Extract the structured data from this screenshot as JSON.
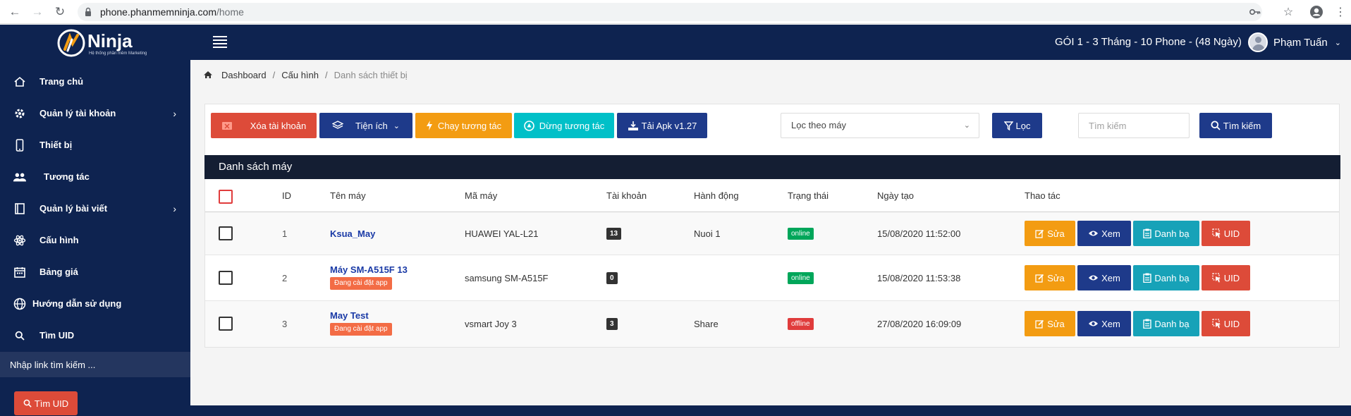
{
  "browser": {
    "url_host": "phone.phanmemninja.com",
    "url_path": "/home"
  },
  "topbar": {
    "logo_text": "Ninja",
    "logo_tagline": "Hệ thống phần mềm Marketing",
    "plan": "GÓI 1 - 3 Tháng - 10 Phone - (48 Ngày)",
    "user_name": "Phạm Tuấn"
  },
  "sidebar": {
    "items": [
      {
        "label": "Trang chủ"
      },
      {
        "label": "Quản lý tài khoản"
      },
      {
        "label": "Thiết bị"
      },
      {
        "label": "Tương tác"
      },
      {
        "label": "Quản lý bài viết"
      },
      {
        "label": "Cấu hình"
      },
      {
        "label": "Bảng giá"
      },
      {
        "label": "Hướng dẫn sử dụng"
      },
      {
        "label": "Tìm UID"
      }
    ],
    "search_placeholder": "Nhập link tìm kiếm ...",
    "uid_button": "Tìm UID"
  },
  "breadcrumb": {
    "items": [
      "Dashboard",
      "Cấu hình",
      "Danh sách thiết bị"
    ]
  },
  "toolbar": {
    "delete_account": "Xóa tài khoản",
    "utilities": "Tiện ích",
    "run_interaction": "Chạy tương tác",
    "stop_interaction": "Dừng tương tác",
    "download_apk": "Tải Apk v1.27",
    "filter_select": "Lọc theo máy",
    "filter_button": "Lọc",
    "search_placeholder": "Tìm kiếm",
    "search_button": "Tìm kiếm"
  },
  "list": {
    "title": "Danh sách máy",
    "columns": [
      "ID",
      "Tên máy",
      "Mã máy",
      "Tài khoản",
      "Hành động",
      "Trạng thái",
      "Ngày tạo",
      "Thao tác"
    ],
    "rows": [
      {
        "id": "1",
        "name": "Ksua_May",
        "tag": "",
        "model": "HUAWEI YAL-L21",
        "accounts": "13",
        "action": "Nuoi 1",
        "status": "online",
        "created": "15/08/2020 11:52:00"
      },
      {
        "id": "2",
        "name": "Máy SM-A515F 13",
        "tag": "Đang cài đặt app",
        "model": "samsung SM-A515F",
        "accounts": "0",
        "action": "",
        "status": "online",
        "created": "15/08/2020 11:53:38"
      },
      {
        "id": "3",
        "name": "May Test",
        "tag": "Đang cài đặt app",
        "model": "vsmart Joy 3",
        "accounts": "3",
        "action": "Share",
        "status": "offline",
        "created": "27/08/2020 16:09:09"
      }
    ],
    "row_buttons": {
      "edit": "Sửa",
      "view": "Xem",
      "contacts": "Danh bạ",
      "uid": "UID"
    }
  },
  "colors": {
    "navy": "#0e2350",
    "list_header": "#141e33",
    "red": "#dd4b39",
    "orange": "#f39c12",
    "teal": "#00c0c8",
    "blue_btn": "#1e3a8a",
    "contacts_teal": "#17a2b8",
    "online": "#00a65a"
  },
  "icons": {
    "back": "arrow-left-icon",
    "forward": "arrow-right-icon",
    "reload": "reload-icon",
    "lock": "lock-icon",
    "key": "key-icon",
    "star": "star-icon",
    "profile": "account-circle-icon",
    "menu": "hamburger-icon"
  }
}
